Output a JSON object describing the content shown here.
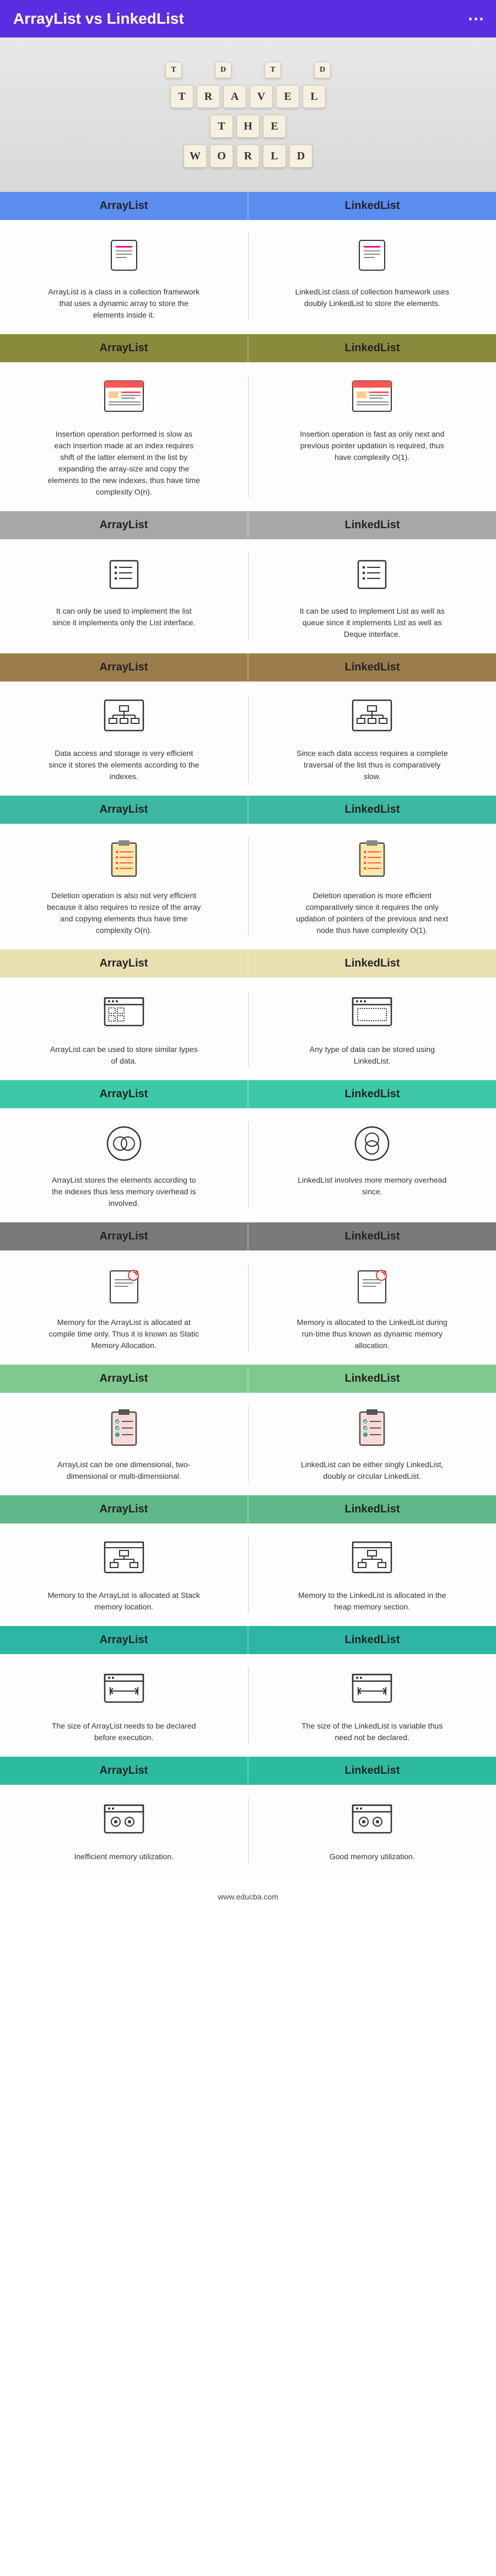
{
  "title": "ArrayList vs LinkedList",
  "hero": {
    "row1": [
      "T",
      "D",
      "T",
      "D"
    ],
    "row2": [
      "T",
      "R",
      "A",
      "V",
      "E",
      "L"
    ],
    "row3": [
      "T",
      "H",
      "E"
    ],
    "row4": [
      "W",
      "O",
      "R",
      "L",
      "D"
    ]
  },
  "labels": {
    "left": "ArrayList",
    "right": "LinkedList"
  },
  "sections": [
    {
      "color": "c-blue",
      "left": "ArrayList is a class in a collection framework that uses a dynamic array to store the elements inside it.",
      "right": "LinkedList class of collection framework uses doubly LinkedList to store the elements."
    },
    {
      "color": "c-olive",
      "left": "Insertion operation performed is slow as each insertion made at an index requires shift of the latter element in the list by expanding the array-size and copy the elements to the new indexes, thus have time complexity O(n).",
      "right": "Insertion operation is fast as only next and previous pointer updation is required, thus have complexity O(1)."
    },
    {
      "color": "c-gray",
      "left": "It can only be used to implement the list since it implements only the List interface.",
      "right": "It can be used to implement List as well as queue since it implements List as well as Deque interface."
    },
    {
      "color": "c-brown",
      "left": "Data access and storage is very efficient since it stores the elements according to the indexes.",
      "right": "Since each data access requires a complete traversal of the list thus is comparatively slow."
    },
    {
      "color": "c-teal",
      "left": "Deletion operation is also not very efficient because it also requires to resize of the array and copying elements thus have time complexity O(n).",
      "right": "Deletion operation is more efficient comparatively since it requires the only updation of pointers of the previous and next node thus have complexity O(1)."
    },
    {
      "color": "c-cream",
      "left": "ArrayList can be used to store similar types of data.",
      "right": "Any type of data can be stored using LinkedList."
    },
    {
      "color": "c-mint",
      "left": "ArrayList stores the elements according to the indexes thus less memory overhead is involved.",
      "right": "LinkedList involves more memory overhead since."
    },
    {
      "color": "c-dgray",
      "left": "Memory for the ArrayList is allocated at compile time only. Thus it is known as Static Memory Allocation.",
      "right": "Memory is allocated to the LinkedList during run-time thus known as dynamic memory allocation."
    },
    {
      "color": "c-lgreen",
      "left": "ArrayList can be one dimensional, two-dimensional or multi-dimensional.",
      "right": "LinkedList can be either singly LinkedList, doubly or circular LinkedList."
    },
    {
      "color": "c-green2",
      "left": "Memory to the ArrayList is allocated at Stack memory location.",
      "right": "Memory to the LinkedList is allocated in the heap memory section."
    },
    {
      "color": "c-teal2",
      "left": "The size of ArrayList needs to be declared before execution.",
      "right": "The size of the LinkedList is variable thus need not be declared."
    },
    {
      "color": "c-teal3",
      "left": "Inefficient memory utilization.",
      "right": "Good memory utilization."
    }
  ],
  "footer": "www.educba.com"
}
